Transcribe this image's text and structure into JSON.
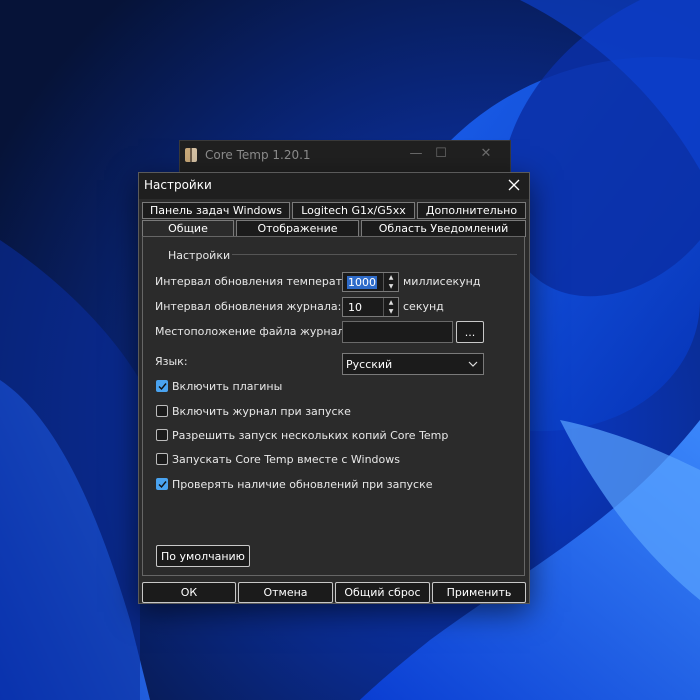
{
  "background_window": {
    "title": "Core Temp 1.20.1",
    "controls": {
      "minimize": "—",
      "maximize": "☐",
      "close": "✕"
    }
  },
  "dialog": {
    "title": "Настройки",
    "tabs_row_top": [
      "Панель задач Windows",
      "Logitech G1x/G5xx",
      "Дополнительно"
    ],
    "tabs_row_bottom": [
      "Общие",
      "Отображение",
      "Область Уведомлений"
    ],
    "active_tab": "Общие",
    "group_title": "Настройки",
    "fields": {
      "temp_interval_label": "Интервал обновления температур:",
      "temp_interval_value": "1000",
      "temp_interval_unit": "миллисекунд",
      "log_interval_label": "Интервал обновления журнала:",
      "log_interval_value": "10",
      "log_interval_unit": "секунд",
      "log_location_label": "Местоположение файла журнала:",
      "log_location_value": "",
      "browse_label": "...",
      "language_label": "Язык:",
      "language_value": "Русский"
    },
    "checkboxes": [
      {
        "label": "Включить плагины",
        "checked": true
      },
      {
        "label": "Включить журнал при запуске",
        "checked": false
      },
      {
        "label": "Разрешить запуск нескольких копий Core Temp",
        "checked": false
      },
      {
        "label": "Запускать Core Temp вместе с Windows",
        "checked": false
      },
      {
        "label": "Проверять наличие обновлений при запуске",
        "checked": true
      }
    ],
    "defaults_label": "По умолчанию",
    "buttons": {
      "ok": "ОК",
      "cancel": "Отмена",
      "reset": "Общий сброс",
      "apply": "Применить"
    }
  },
  "colors": {
    "accent": "#4aa3f0",
    "selection": "#2e6bc9",
    "dialog_bg": "#2b2b2b",
    "wallpaper_base": "#081a52"
  }
}
